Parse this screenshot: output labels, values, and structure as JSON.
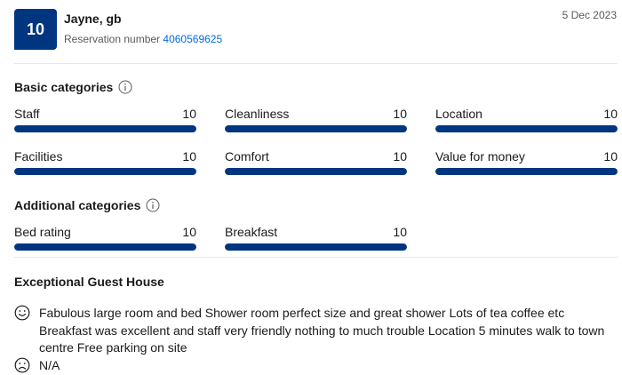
{
  "review": {
    "score": "10",
    "guest_name": "Jayne, gb",
    "reservation_label": "Reservation number",
    "reservation_number": "4060569625",
    "date": "5 Dec 2023"
  },
  "basic": {
    "title": "Basic categories",
    "items": [
      {
        "label": "Staff",
        "value": "10",
        "fill": 1.0
      },
      {
        "label": "Cleanliness",
        "value": "10",
        "fill": 1.0
      },
      {
        "label": "Location",
        "value": "10",
        "fill": 1.0
      },
      {
        "label": "Facilities",
        "value": "10",
        "fill": 1.0
      },
      {
        "label": "Comfort",
        "value": "10",
        "fill": 1.0
      },
      {
        "label": "Value for money",
        "value": "10",
        "fill": 1.0
      }
    ]
  },
  "additional": {
    "title": "Additional categories",
    "items": [
      {
        "label": "Bed rating",
        "value": "10",
        "fill": 1.0
      },
      {
        "label": "Breakfast",
        "value": "10",
        "fill": 1.0
      }
    ]
  },
  "comment": {
    "title": "Exceptional Guest House",
    "positive": "Fabulous large room and bed Shower room perfect size and great shower Lots of tea coffee etc Breakfast was excellent and staff very friendly nothing to much trouble Location 5 minutes walk to town centre Free parking on site",
    "negative": "N/A"
  },
  "colors": {
    "brand": "#003580",
    "link": "#006ce4",
    "track": "#e7e7e7"
  },
  "icons": {
    "info": "info-icon",
    "positive": "smile-face-icon",
    "negative": "sad-face-icon"
  }
}
